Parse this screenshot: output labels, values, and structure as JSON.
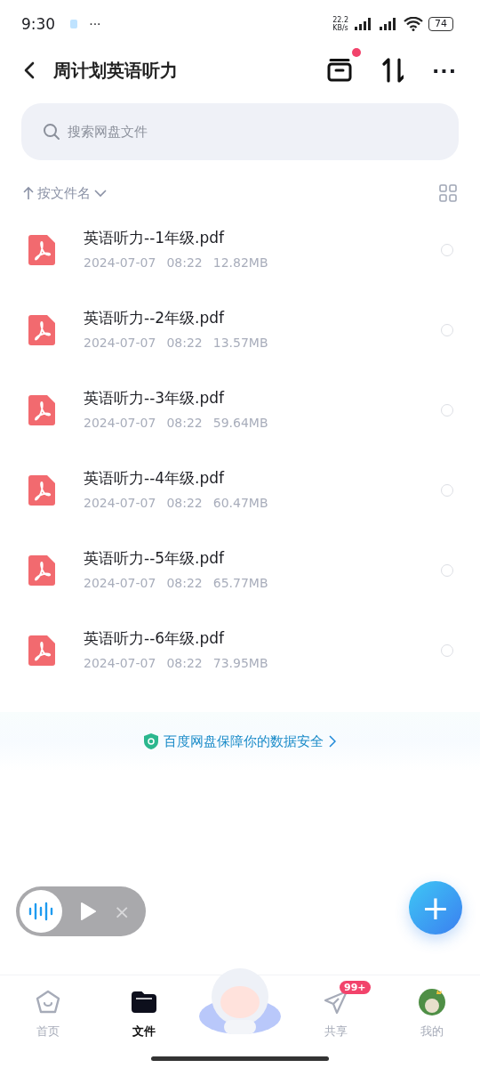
{
  "status_bar": {
    "time": "9:30",
    "more": "···",
    "net_speed_value": "22.2",
    "net_speed_unit": "KB/s",
    "battery": "74"
  },
  "header": {
    "title": "周计划英语听力",
    "has_notification_dot": true,
    "more": "···"
  },
  "search": {
    "placeholder": "搜索网盘文件"
  },
  "sort": {
    "label": "按文件名"
  },
  "files": [
    {
      "name": "英语听力--1年级.pdf",
      "date": "2024-07-07",
      "time": "08:22",
      "size": "12.82MB",
      "selected": false
    },
    {
      "name": "英语听力--2年级.pdf",
      "date": "2024-07-07",
      "time": "08:22",
      "size": "13.57MB",
      "selected": false
    },
    {
      "name": "英语听力--3年级.pdf",
      "date": "2024-07-07",
      "time": "08:22",
      "size": "59.64MB",
      "selected": false
    },
    {
      "name": "英语听力--4年级.pdf",
      "date": "2024-07-07",
      "time": "08:22",
      "size": "60.47MB",
      "selected": false
    },
    {
      "name": "英语听力--5年级.pdf",
      "date": "2024-07-07",
      "time": "08:22",
      "size": "65.77MB",
      "selected": false
    },
    {
      "name": "英语听力--6年级.pdf",
      "date": "2024-07-07",
      "time": "08:22",
      "size": "73.95MB",
      "selected": false
    }
  ],
  "security_banner": {
    "text": "百度网盘保障你的数据安全"
  },
  "player": {
    "close": "×"
  },
  "fab": {
    "label": "+"
  },
  "tabs": [
    {
      "kind": "home",
      "label": "首页",
      "selected": false
    },
    {
      "kind": "files",
      "label": "文件",
      "selected": true
    },
    {
      "kind": "mascot"
    },
    {
      "kind": "share",
      "label": "共享",
      "selected": false,
      "badge": "99+"
    },
    {
      "kind": "me",
      "label": "我的",
      "selected": false
    }
  ]
}
